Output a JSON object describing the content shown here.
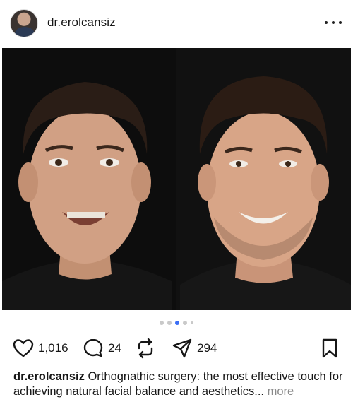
{
  "post": {
    "username": "dr.erolcansiz",
    "likes": "1,016",
    "comments": "24",
    "shares": "294",
    "caption_author": "dr.erolcansiz",
    "caption_text": " Orthognathic surgery: the most effective touch for achieving natural facial balance and aesthetics",
    "caption_ellipsis": "...",
    "caption_more": " more",
    "carousel": {
      "total": 6,
      "active_index": 2
    }
  },
  "colors": {
    "accent": "#3b6ff5",
    "text": "#161616",
    "muted": "#8a8a8a"
  },
  "icons": [
    "more-icon",
    "heart-icon",
    "comment-icon",
    "repost-icon",
    "send-icon",
    "bookmark-icon"
  ]
}
